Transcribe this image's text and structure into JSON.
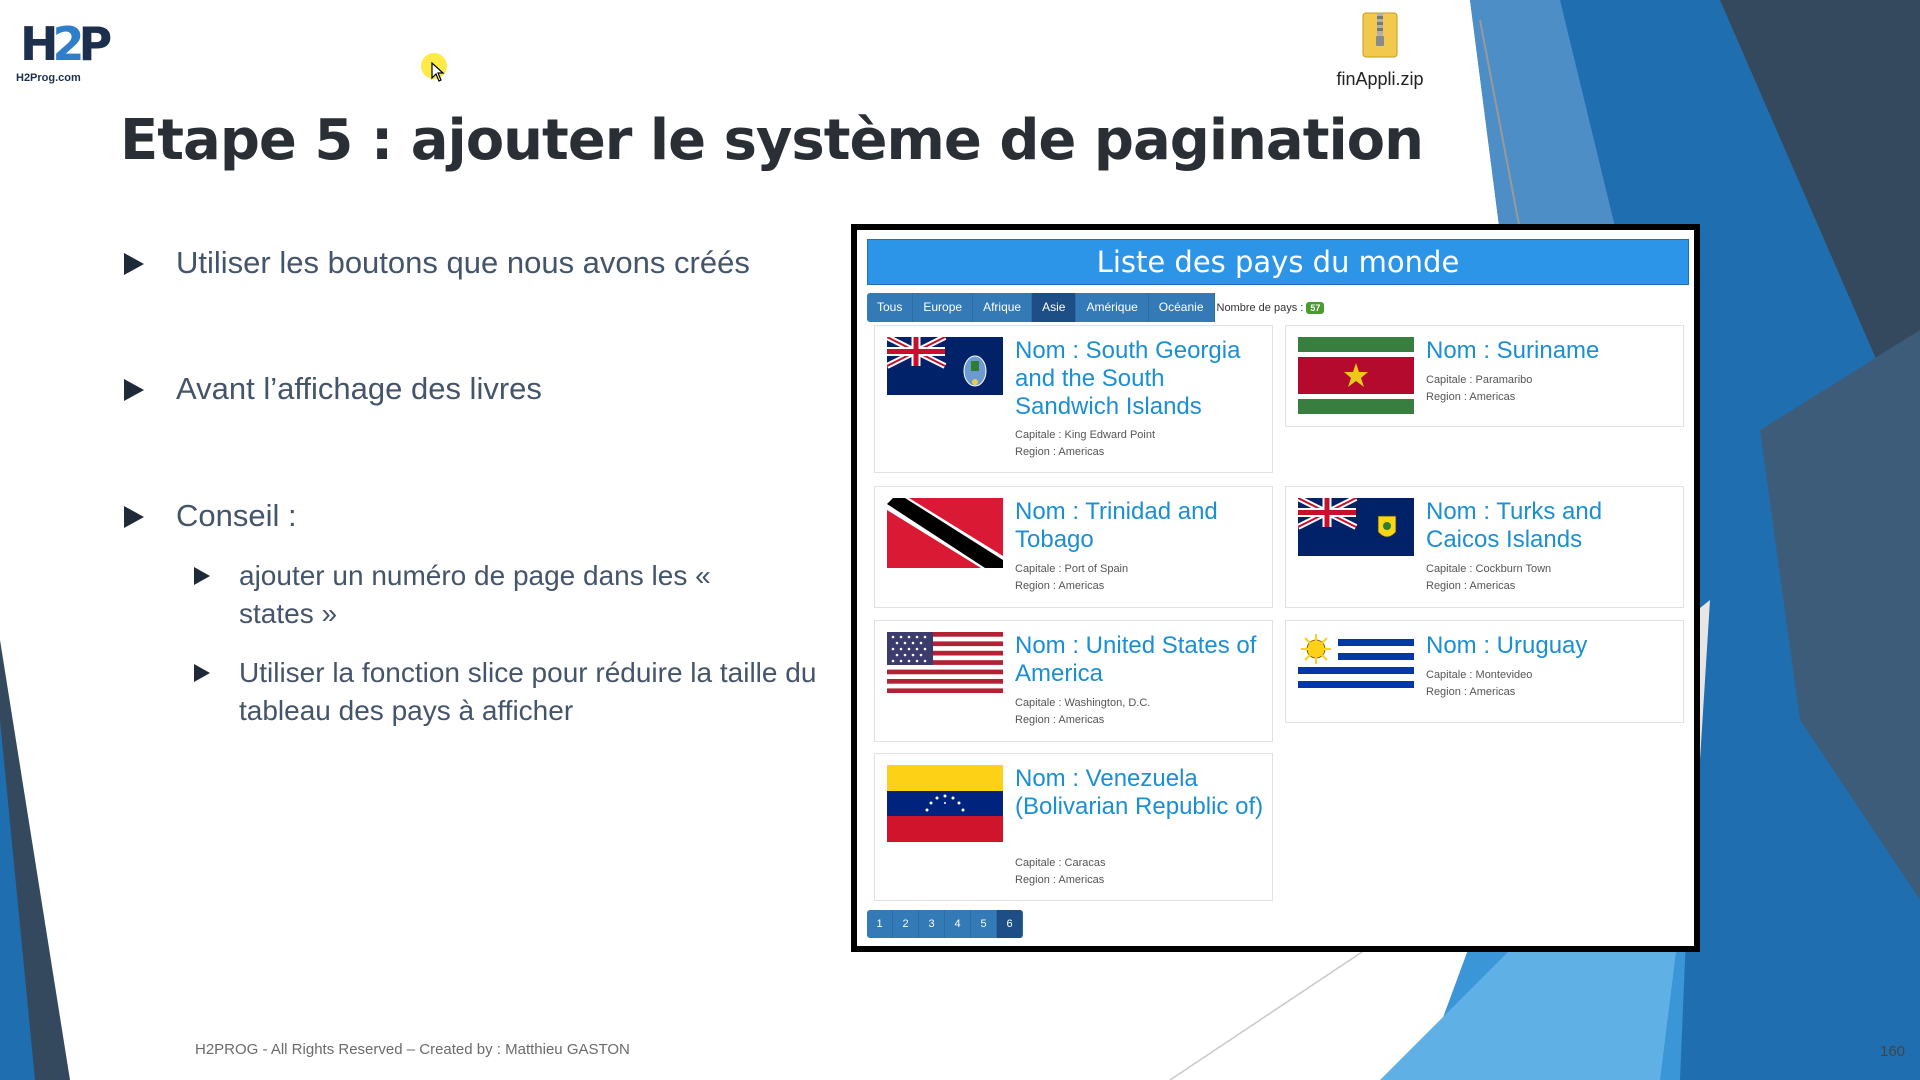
{
  "slide": {
    "logo_text": "H2Prog.com",
    "title": "Etape 5 : ajouter le système de pagination",
    "bullets": [
      "Utiliser les boutons que nous avons créés",
      "Avant l’affichage des livres",
      "Conseil :"
    ],
    "sub_bullets": [
      "ajouter un numéro de page dans les « states »",
      "Utiliser la fonction slice pour réduire la taille du tableau des pays à afficher"
    ],
    "footer": "H2PROG - All Rights Reserved – Created by : Matthieu GASTON",
    "page_number": "160"
  },
  "desktop": {
    "zip_label": "finAppli.zip"
  },
  "app": {
    "title": "Liste des pays du monde",
    "filters": [
      "Tous",
      "Europe",
      "Afrique",
      "Asie",
      "Amérique",
      "Océanie"
    ],
    "active_filter": "Asie",
    "count_label": "Nombre de pays :",
    "count": "57",
    "cards": [
      {
        "name": "Nom : South Georgia and the South Sandwich Islands",
        "capital": "Capitale : King Edward Point",
        "region": "Region : Americas"
      },
      {
        "name": "Nom : Suriname",
        "capital": "Capitale : Paramaribo",
        "region": "Region : Americas"
      },
      {
        "name": "Nom : Trinidad and Tobago",
        "capital": "Capitale : Port of Spain",
        "region": "Region : Americas"
      },
      {
        "name": "Nom : Turks and Caicos Islands",
        "capital": "Capitale : Cockburn Town",
        "region": "Region : Americas"
      },
      {
        "name": "Nom : United States of America",
        "capital": "Capitale : Washington, D.C.",
        "region": "Region : Americas"
      },
      {
        "name": "Nom : Uruguay",
        "capital": "Capitale : Montevideo",
        "region": "Region : Americas"
      },
      {
        "name": "Nom : Venezuela (Bolivarian Republic of)",
        "capital": "Capitale : Caracas",
        "region": "Region : Americas"
      }
    ],
    "pages": [
      "1",
      "2",
      "3",
      "4",
      "5",
      "6"
    ],
    "active_page": "6"
  },
  "colors": {
    "accent": "#2d95e8",
    "button": "#337ab7",
    "button_active": "#1d4f86",
    "link": "#1b8fd3"
  }
}
